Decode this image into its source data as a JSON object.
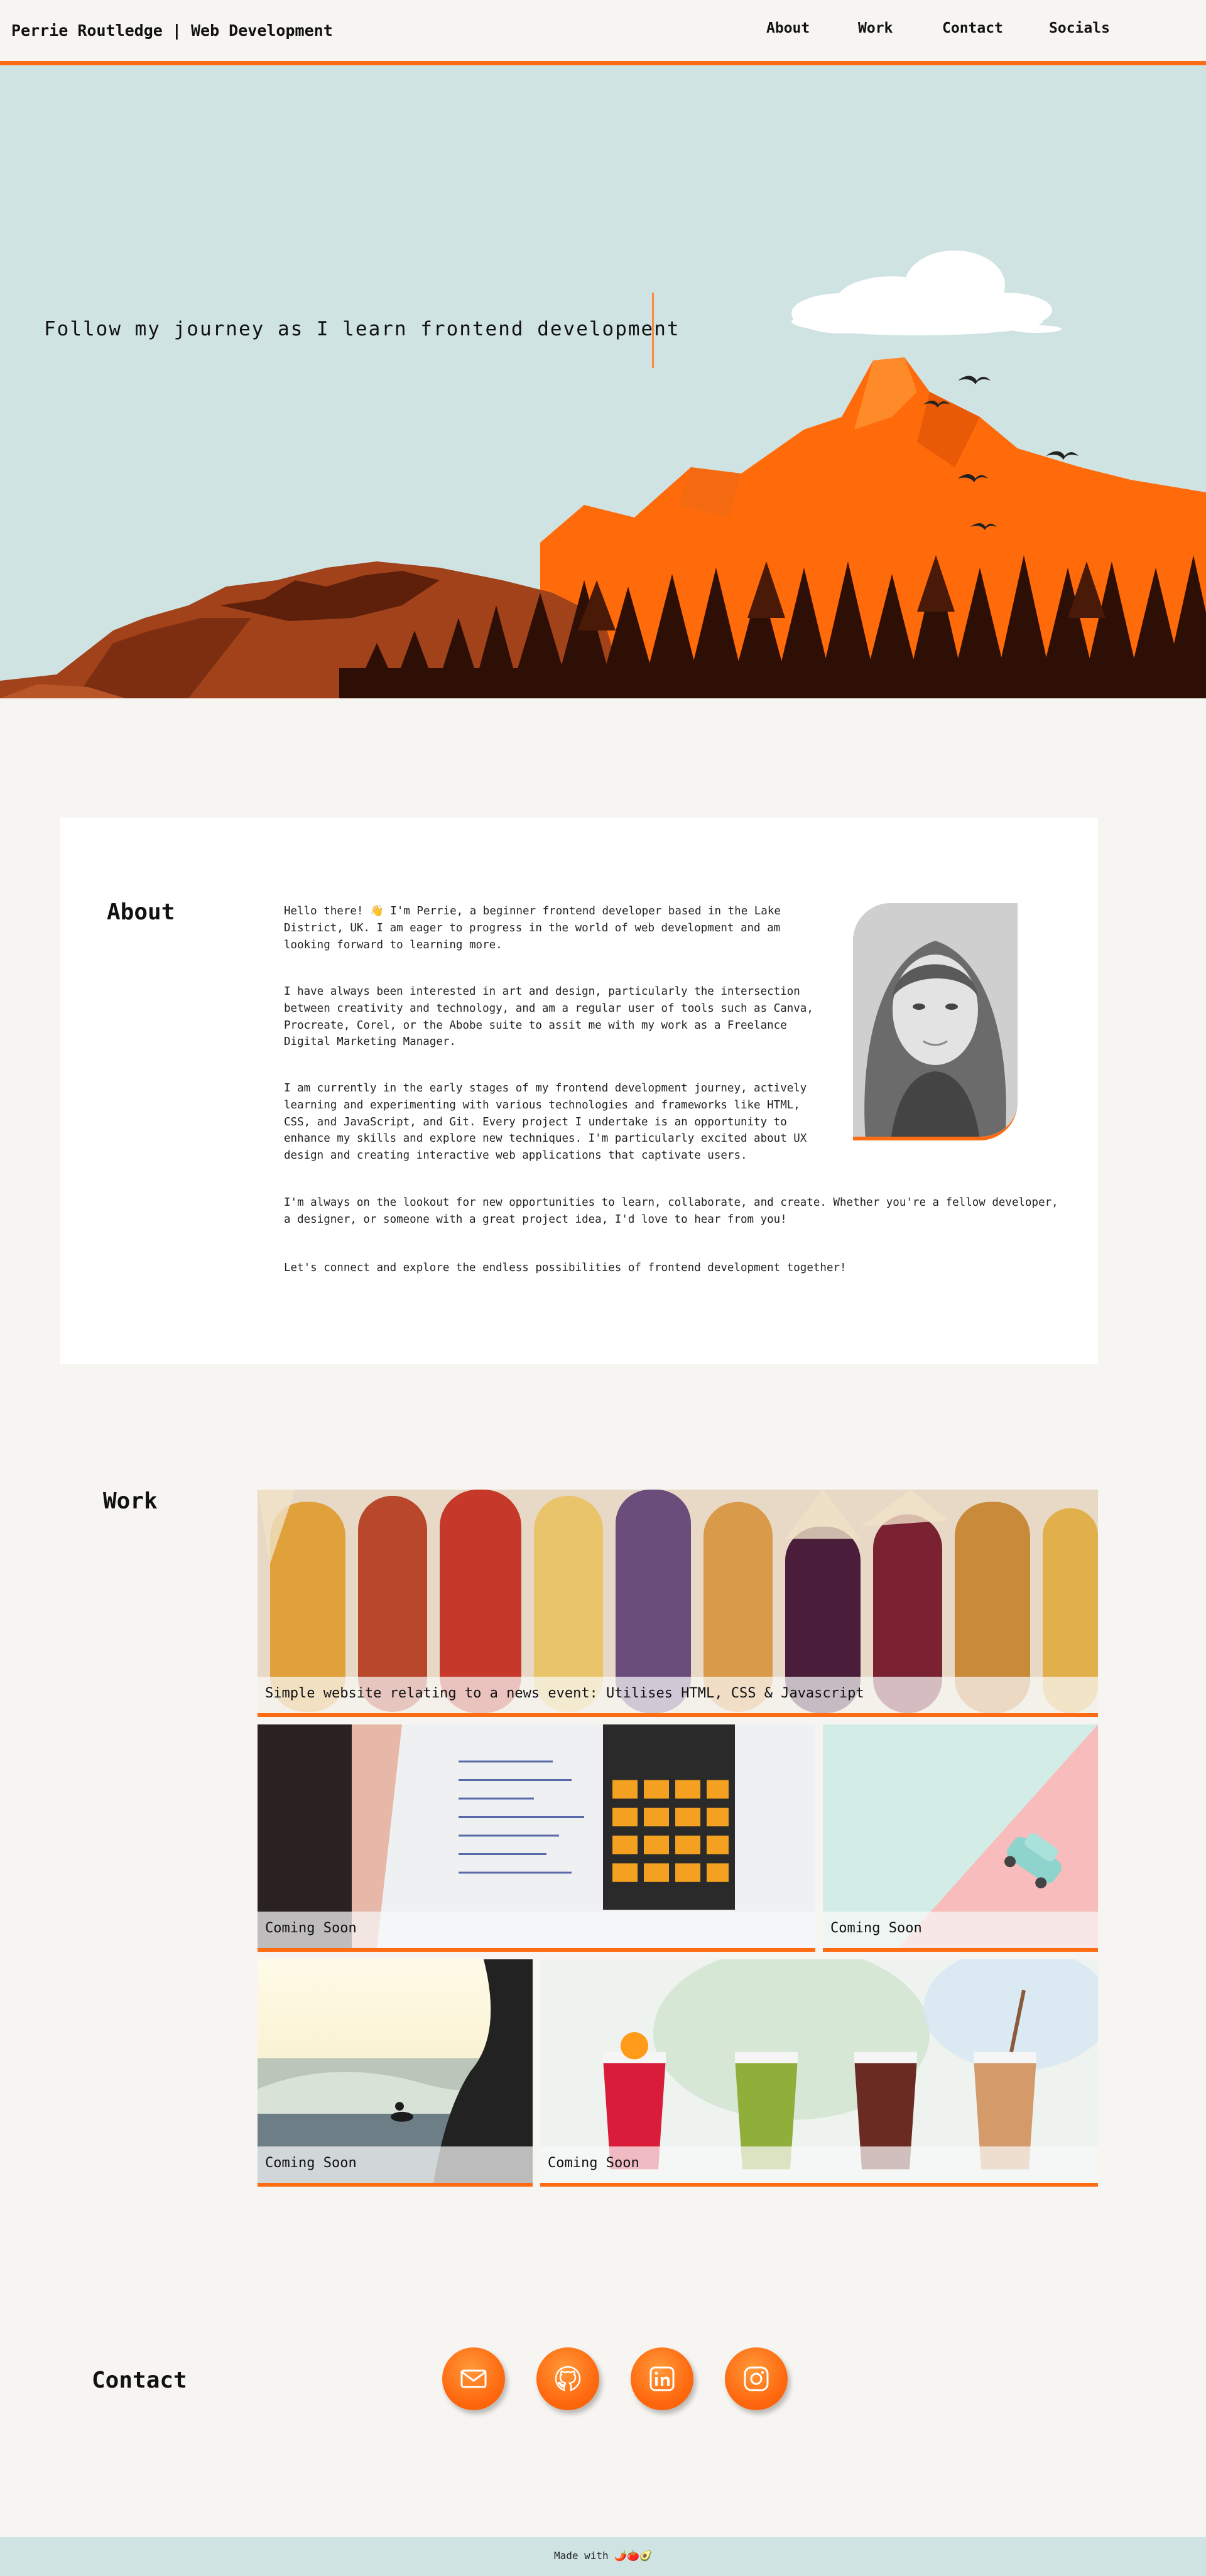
{
  "header": {
    "brand": "Perrie Routledge | Web Development",
    "nav": [
      "About",
      "Work",
      "Contact",
      "Socials"
    ]
  },
  "hero": {
    "tagline": "Follow my journey as I learn frontend development"
  },
  "about": {
    "title": "About",
    "paragraphs": [
      "Hello there! 👋 I'm Perrie, a beginner frontend developer based in the Lake District, UK. I am eager to progress in the world of web development and am looking forward to learning more.",
      "I have always been interested in art and design, particularly the intersection between creativity and technology, and am a regular user of tools such as Canva, Procreate, Corel, or the Abobe suite to assit me with my work as a Freelance Digital Marketing Manager.",
      "I am currently in the early stages of my frontend development journey, actively learning and experimenting with various technologies and frameworks like HTML, CSS, and JavaScript, and Git. Every project I undertake is an opportunity to enhance my skills and explore new techniques. I'm particularly excited about UX design and creating interactive web applications that captivate users.",
      "I'm always on the lookout for new opportunities to learn, collaborate, and create. Whether you're a fellow developer, a designer, or someone with a great project idea, I'd love to hear from you!",
      "Let's connect and explore the endless possibilities of frontend development together!"
    ]
  },
  "work": {
    "title": "Work",
    "projects": [
      {
        "caption": "Simple website relating to a news event: Utilises HTML, CSS & Javascript",
        "image": "corn"
      },
      {
        "caption": "Coming Soon",
        "image": "calculator"
      },
      {
        "caption": "Coming Soon",
        "image": "toy-car"
      },
      {
        "caption": "Coming Soon",
        "image": "surfer"
      },
      {
        "caption": "Coming Soon",
        "image": "drinks"
      }
    ]
  },
  "contact": {
    "title": "Contact",
    "icons": [
      "email-icon",
      "github-icon",
      "linkedin-icon",
      "instagram-icon"
    ]
  },
  "footer": {
    "text": "Made with 🌶️🍅🥑"
  },
  "colors": {
    "accent": "#ff6b12",
    "sky": "#cfe3e3",
    "background": "#f7f5f2"
  }
}
